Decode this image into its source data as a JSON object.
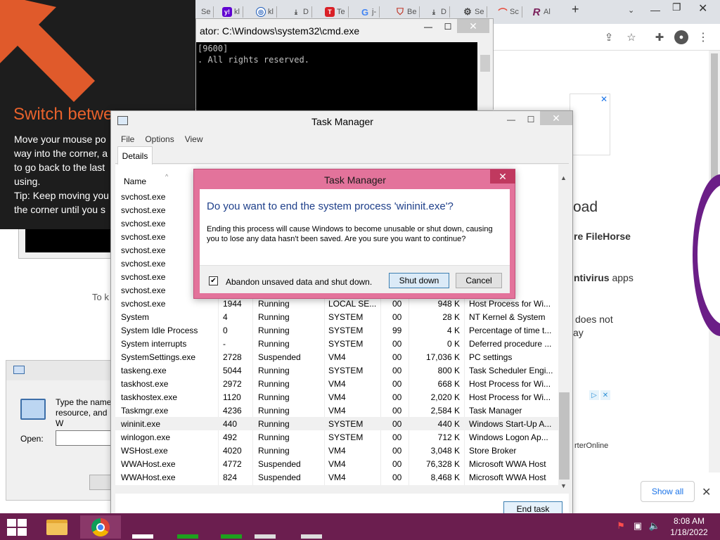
{
  "browser": {
    "tabs": [
      {
        "label": "Se",
        "icon": "generic-tab-icon"
      },
      {
        "label": "kl",
        "icon": "yahoo-icon"
      },
      {
        "label": "kl",
        "icon": "globe-icon"
      },
      {
        "label": "D",
        "icon": "download-icon"
      },
      {
        "label": "Te",
        "icon": "red-t-icon"
      },
      {
        "label": "j-",
        "icon": "google-icon"
      },
      {
        "label": "Be",
        "icon": "shield-icon"
      },
      {
        "label": "D",
        "icon": "download-icon"
      },
      {
        "label": "Se",
        "icon": "gear-icon"
      },
      {
        "label": "Sc",
        "icon": "rainbow-icon"
      },
      {
        "label": "Al",
        "icon": "r-logo-icon"
      }
    ],
    "new_tab": "+",
    "page_fragments": {
      "oad": "oad",
      "filehorse": "re FileHorse",
      "antivirus_bold": "ntivirus",
      "antivirus_rest": " apps",
      "does_not": "does not",
      "ay": "ay",
      "rteronline": "rterOnline",
      "to_k": "To k"
    },
    "show_all": "Show all"
  },
  "charm_hint": {
    "title": "Switch betwe",
    "body": "Move your mouse po\nway into the corner, a\nto go back to the last\nusing.\nTip: Keep moving you\nthe corner until you s"
  },
  "run_dialog": {
    "description": "Type the name\nresource, and W",
    "open_label": "Open:"
  },
  "cmd": {
    "title": "ator: C:\\Windows\\system32\\cmd.exe",
    "line1": "[9600]",
    "line2": ". All rights reserved."
  },
  "task_manager": {
    "title": "Task Manager",
    "menu": [
      "File",
      "Options",
      "View"
    ],
    "tab": "Details",
    "header_name": "Name",
    "rows": [
      {
        "name": "svchost.exe",
        "pid": "",
        "status": "",
        "user": "",
        "cpu": "",
        "mem": "",
        "desc": "s for Wi..."
      },
      {
        "name": "svchost.exe",
        "pid": "",
        "status": "",
        "user": "",
        "cpu": "",
        "mem": "",
        "desc": "s for Wi..."
      },
      {
        "name": "svchost.exe",
        "pid": "",
        "status": "",
        "user": "",
        "cpu": "",
        "mem": "",
        "desc": "s for Wi..."
      },
      {
        "name": "svchost.exe",
        "pid": "",
        "status": "",
        "user": "",
        "cpu": "",
        "mem": "",
        "desc": "s for Wi..."
      },
      {
        "name": "svchost.exe",
        "pid": "",
        "status": "",
        "user": "",
        "cpu": "",
        "mem": "",
        "desc": "s for Wi..."
      },
      {
        "name": "svchost.exe",
        "pid": "",
        "status": "",
        "user": "",
        "cpu": "",
        "mem": "",
        "desc": "s for Wi..."
      },
      {
        "name": "svchost.exe",
        "pid": "",
        "status": "",
        "user": "",
        "cpu": "",
        "mem": "",
        "desc": "s for Wi..."
      },
      {
        "name": "svchost.exe",
        "pid": "",
        "status": "",
        "user": "",
        "cpu": "",
        "mem": "",
        "desc": "s for Wi..."
      },
      {
        "name": "svchost.exe",
        "pid": "1944",
        "status": "Running",
        "user": "LOCAL SE...",
        "cpu": "00",
        "mem": "948 K",
        "desc": "Host Process for Wi..."
      },
      {
        "name": "System",
        "pid": "4",
        "status": "Running",
        "user": "SYSTEM",
        "cpu": "00",
        "mem": "28 K",
        "desc": "NT Kernel & System"
      },
      {
        "name": "System Idle Process",
        "pid": "0",
        "status": "Running",
        "user": "SYSTEM",
        "cpu": "99",
        "mem": "4 K",
        "desc": "Percentage of time t..."
      },
      {
        "name": "System interrupts",
        "pid": "-",
        "status": "Running",
        "user": "SYSTEM",
        "cpu": "00",
        "mem": "0 K",
        "desc": "Deferred procedure ..."
      },
      {
        "name": "SystemSettings.exe",
        "pid": "2728",
        "status": "Suspended",
        "user": "VM4",
        "cpu": "00",
        "mem": "17,036 K",
        "desc": "PC settings"
      },
      {
        "name": "taskeng.exe",
        "pid": "5044",
        "status": "Running",
        "user": "SYSTEM",
        "cpu": "00",
        "mem": "800 K",
        "desc": "Task Scheduler Engi..."
      },
      {
        "name": "taskhost.exe",
        "pid": "2972",
        "status": "Running",
        "user": "VM4",
        "cpu": "00",
        "mem": "668 K",
        "desc": "Host Process for Wi..."
      },
      {
        "name": "taskhostex.exe",
        "pid": "1120",
        "status": "Running",
        "user": "VM4",
        "cpu": "00",
        "mem": "2,020 K",
        "desc": "Host Process for Wi..."
      },
      {
        "name": "Taskmgr.exe",
        "pid": "4236",
        "status": "Running",
        "user": "VM4",
        "cpu": "00",
        "mem": "2,584 K",
        "desc": "Task Manager"
      },
      {
        "name": "wininit.exe",
        "pid": "440",
        "status": "Running",
        "user": "SYSTEM",
        "cpu": "00",
        "mem": "440 K",
        "desc": "Windows Start-Up A..."
      },
      {
        "name": "winlogon.exe",
        "pid": "492",
        "status": "Running",
        "user": "SYSTEM",
        "cpu": "00",
        "mem": "712 K",
        "desc": "Windows Logon Ap..."
      },
      {
        "name": "WSHost.exe",
        "pid": "4020",
        "status": "Running",
        "user": "VM4",
        "cpu": "00",
        "mem": "3,048 K",
        "desc": "Store Broker"
      },
      {
        "name": "WWAHost.exe",
        "pid": "4772",
        "status": "Suspended",
        "user": "VM4",
        "cpu": "00",
        "mem": "76,328 K",
        "desc": "Microsoft WWA Host"
      },
      {
        "name": "WWAHost.exe",
        "pid": "824",
        "status": "Suspended",
        "user": "VM4",
        "cpu": "00",
        "mem": "8,468 K",
        "desc": "Microsoft WWA Host"
      }
    ],
    "end_task": "End task"
  },
  "confirm_dialog": {
    "title": "Task Manager",
    "heading": "Do you want to end the system process 'wininit.exe'?",
    "message": "Ending this process will cause Windows to become unusable or shut down, causing you to lose any data hasn't been saved. Are you sure you want to continue?",
    "checkbox_label": "Abandon unsaved data and shut down.",
    "checkbox_checked": true,
    "shutdown": "Shut down",
    "cancel": "Cancel",
    "accent_color": "#e3739b"
  },
  "taskbar": {
    "time": "8:08 AM",
    "date": "1/18/2022",
    "color": "#6b1e4f"
  }
}
